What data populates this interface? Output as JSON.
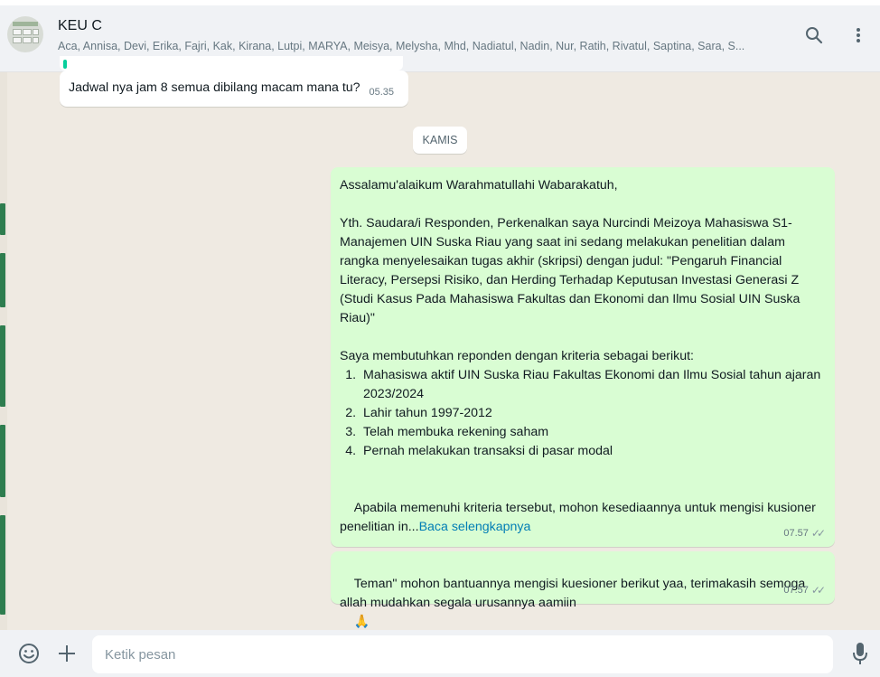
{
  "header": {
    "title": "KEU C",
    "members": "Aca, Annisa, Devi, Erika, Fajri, Kak, Kirana, Lutpi, MARYA, Meisya, Melysha, Mhd, Nadiatul, Nadin, Nur, Ratih, Rivatul, Saptina, Sara, S...",
    "icons": [
      "group-avatar",
      "search-icon",
      "menu-icon"
    ]
  },
  "messages": {
    "incoming": {
      "text": "Jadwal nya jam 8 semua dibilang macam mana tu?",
      "time": "05.35"
    },
    "date_separator": "KAMIS",
    "outgoing_1": {
      "greeting": "Assalamu'alaikum Warahmatullahi Wabarakatuh,",
      "intro": "Yth. Saudara/i Responden, Perkenalkan saya Nurcindi Meizoya Mahasiswa S1-Manajemen UIN Suska Riau yang saat ini sedang melakukan penelitian dalam rangka menyelesaikan tugas akhir (skripsi) dengan judul: \"Pengaruh Financial Literacy, Persepsi Risiko, dan Herding Terhadap Keputusan Investasi Generasi Z (Studi Kasus Pada Mahasiswa Fakultas dan Ekonomi dan Ilmu Sosial UIN Suska Riau)\"",
      "criteria_intro": "Saya membutuhkan reponden dengan kriteria sebagai berikut:",
      "criteria": [
        "Mahasiswa aktif UIN Suska Riau Fakultas Ekonomi dan Ilmu Sosial tahun ajaran 2023/2024",
        "Lahir tahun 1997-2012",
        "Telah membuka rekening saham",
        "Pernah melakukan transaksi di pasar modal"
      ],
      "closing": "Apabila memenuhi kriteria tersebut, mohon kesediaannya untuk mengisi kusioner penelitian in...",
      "read_more": "Baca selengkapnya",
      "time": "07.57",
      "ticks": "✓✓"
    },
    "outgoing_2": {
      "text": "Teman\" mohon bantuannya mengisi kuesioner berikut yaa, terimakasih semoga allah mudahkan segala urusannya aamiin",
      "emoji": "🙏",
      "time": "07.57",
      "ticks": "✓✓"
    }
  },
  "composer": {
    "placeholder": "Ketik pesan",
    "icons": [
      "emoji-icon",
      "plus-icon",
      "microphone-icon"
    ]
  },
  "colors": {
    "outgoing_bubble": "#d9fdd3",
    "incoming_bubble": "#ffffff",
    "chat_background": "#efeae2",
    "link": "#027eb5"
  }
}
